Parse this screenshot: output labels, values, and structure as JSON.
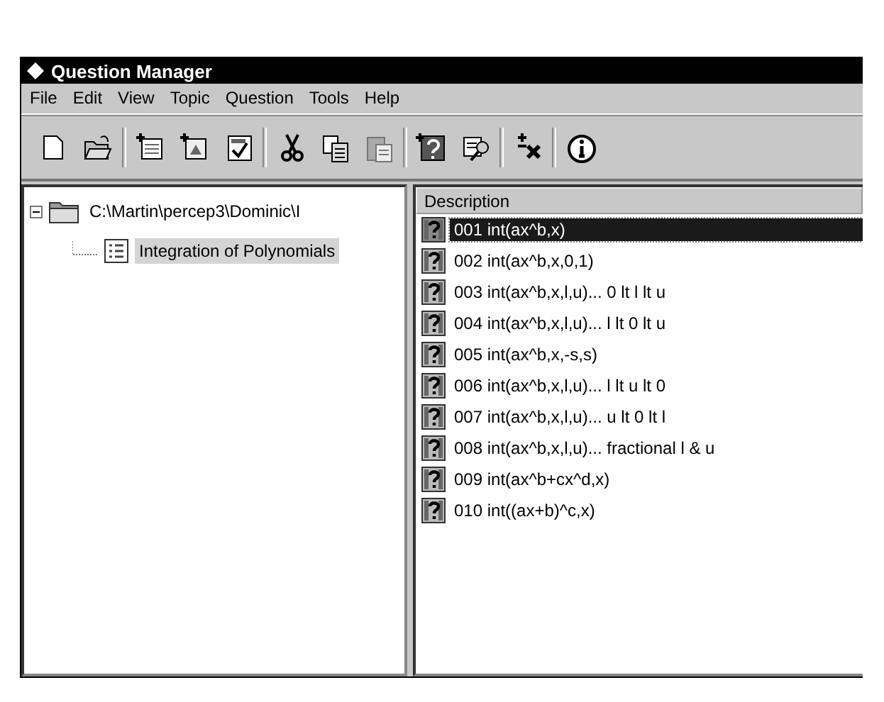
{
  "window": {
    "title": "Question Manager"
  },
  "menu": [
    {
      "label": "File"
    },
    {
      "label": "Edit"
    },
    {
      "label": "View"
    },
    {
      "label": "Topic"
    },
    {
      "label": "Question"
    },
    {
      "label": "Tools"
    },
    {
      "label": "Help"
    }
  ],
  "tree": [
    {
      "label": "C:\\Martin\\percep3\\Dominic\\I",
      "kind": "folder",
      "expanded": true,
      "selected": false,
      "children": [
        {
          "label": "Integration of Polynomials",
          "kind": "topic",
          "selected": true
        }
      ]
    }
  ],
  "list": {
    "columns": [
      "Description"
    ],
    "rows": [
      {
        "label": "001 int(ax^b,x)",
        "selected": true
      },
      {
        "label": "002 int(ax^b,x,0,1)",
        "selected": false
      },
      {
        "label": "003 int(ax^b,x,l,u)... 0 lt l lt u",
        "selected": false
      },
      {
        "label": "004 int(ax^b,x,l,u)... l lt 0 lt u",
        "selected": false
      },
      {
        "label": "005 int(ax^b,x,-s,s)",
        "selected": false
      },
      {
        "label": "006 int(ax^b,x,l,u)... l lt u lt 0",
        "selected": false
      },
      {
        "label": "007 int(ax^b,x,l,u)... u lt 0 lt l",
        "selected": false
      },
      {
        "label": "008 int(ax^b,x,l,u)... fractional l & u",
        "selected": false
      },
      {
        "label": "009 int(ax^b+cx^d,x)",
        "selected": false
      },
      {
        "label": "010 int((ax+b)^c,x)",
        "selected": false
      }
    ]
  }
}
